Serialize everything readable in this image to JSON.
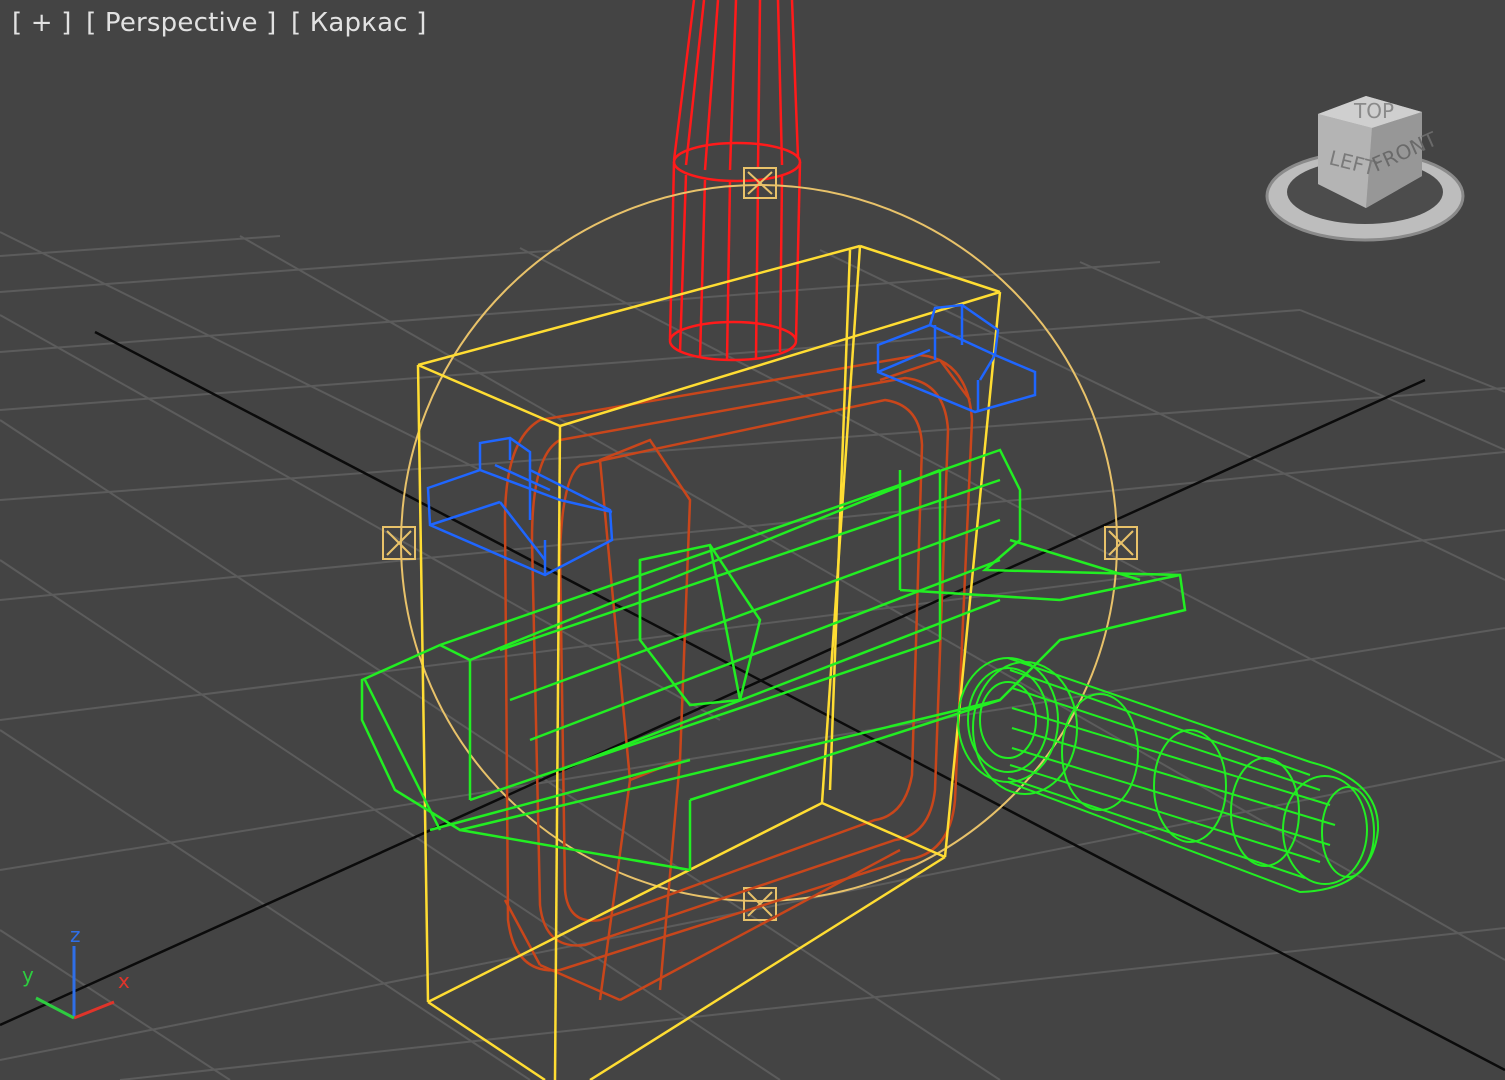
{
  "viewport": {
    "labels": {
      "plus": "[ + ]",
      "view": "[ Perspective ]",
      "shading": "[ Каркас ]"
    },
    "background_color": "#444444",
    "grid_color": "#5a5a5a",
    "world_axis_color": "#0a0a0a"
  },
  "viewcube": {
    "face_left": "LEFT",
    "face_front": "FRONT",
    "face_top": "TOP"
  },
  "axis_tripod": {
    "x_label": "x",
    "y_label": "y",
    "z_label": "z",
    "x_color": "#e0342a",
    "y_color": "#2ecc40",
    "z_color": "#2f6fe8"
  },
  "objects": [
    {
      "name": "shaft",
      "color": "#ff1a1a"
    },
    {
      "name": "housing-box",
      "color": "#ffdd33"
    },
    {
      "name": "inner-frame",
      "color": "#c9461b"
    },
    {
      "name": "clamps",
      "color": "#1f66ff"
    },
    {
      "name": "handle-assembly",
      "color": "#22ee22"
    },
    {
      "name": "rotate-gizmo",
      "color": "#e8c26a"
    }
  ]
}
